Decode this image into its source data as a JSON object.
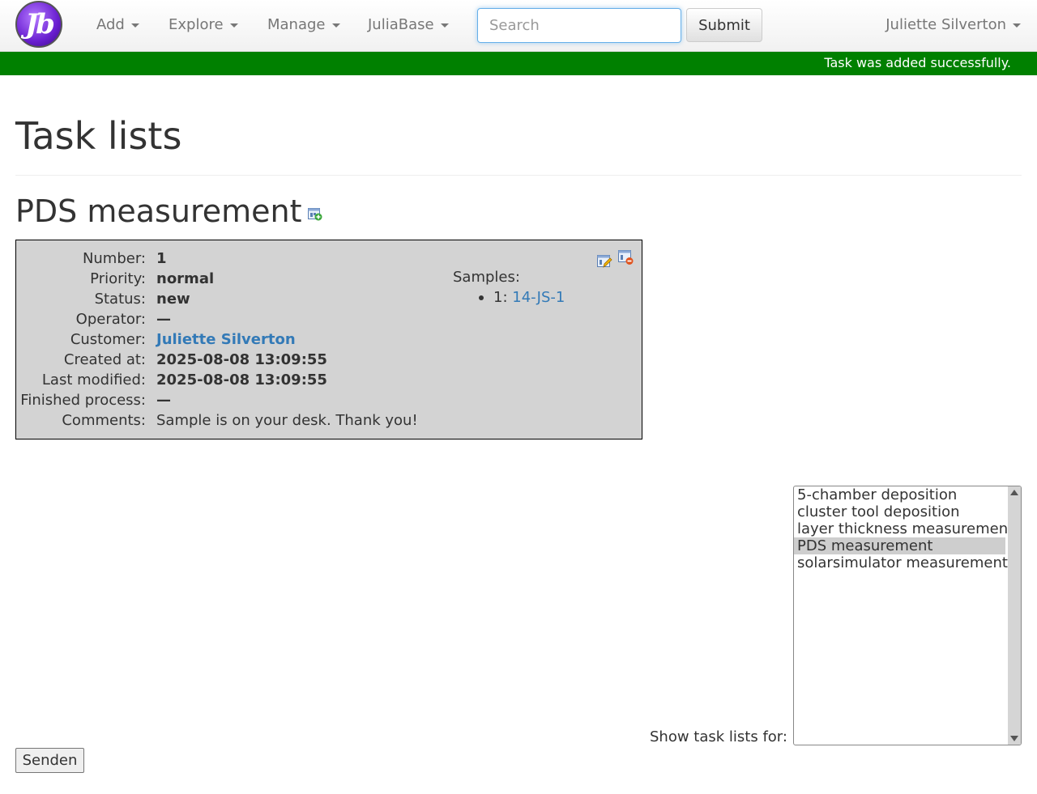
{
  "navbar": {
    "logo_text": "Jb",
    "menus": [
      {
        "label": "Add"
      },
      {
        "label": "Explore"
      },
      {
        "label": "Manage"
      },
      {
        "label": "JuliaBase"
      }
    ],
    "search_placeholder": "Search",
    "submit_label": "Submit",
    "user_name": "Juliette Silverton"
  },
  "flash_message": "Task was added successfully.",
  "page_title": "Task lists",
  "section": {
    "title": "PDS measurement",
    "add_icon": "add-task-icon"
  },
  "task": {
    "fields": [
      {
        "label": "Number:",
        "value": "1"
      },
      {
        "label": "Priority:",
        "value": "normal"
      },
      {
        "label": "Status:",
        "value": "new"
      },
      {
        "label": "Operator:",
        "value": "—"
      },
      {
        "label": "Customer:",
        "value": "Juliette Silverton",
        "link": true
      },
      {
        "label": "Created at:",
        "value": "2025-08-08 13:09:55"
      },
      {
        "label": "Last modified:",
        "value": "2025-08-08 13:09:55"
      },
      {
        "label": "Finished process:",
        "value": "—"
      },
      {
        "label": "Comments:",
        "value": "Sample is on your desk. Thank you!",
        "plain": true
      }
    ],
    "samples_label": "Samples:",
    "samples": [
      {
        "index": "1:",
        "name": "14-JS-1"
      }
    ],
    "edit_icon": "edit-task-icon",
    "delete_icon": "delete-task-icon"
  },
  "filter": {
    "label": "Show task lists for:",
    "options": [
      "5-chamber deposition",
      "cluster tool deposition",
      "layer thickness measurement",
      "PDS measurement",
      "solarsimulator measurement"
    ],
    "selected": "PDS measurement",
    "submit_label": "Senden"
  },
  "colors": {
    "success": "#008000",
    "link": "#337ab7",
    "task_bg": "#d3d3d3"
  }
}
